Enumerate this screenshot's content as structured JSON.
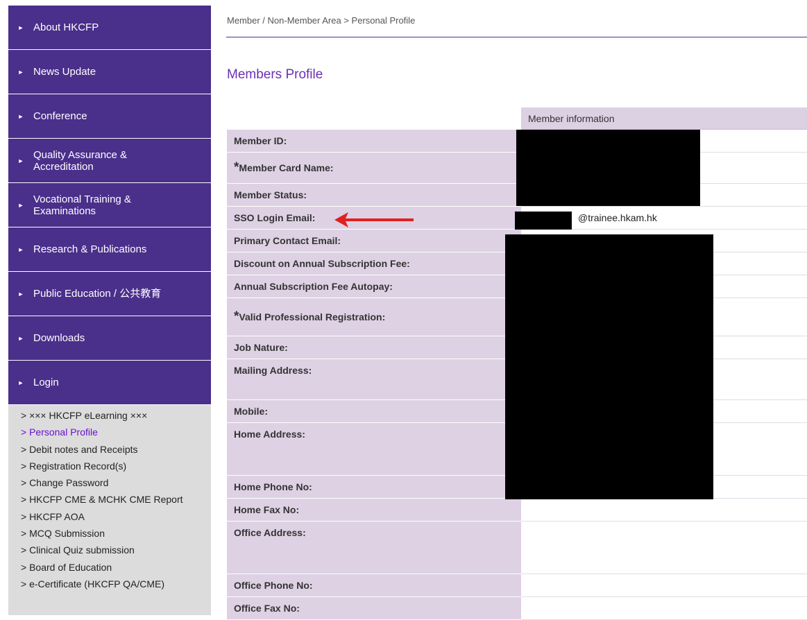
{
  "colors": {
    "nav_bg": "#4a2f8b",
    "submenu_bg": "#dcdcdc",
    "active_link": "#6a0fd6",
    "title": "#6a2fb5",
    "label_bg": "#ddd1e3",
    "arrow": "#e02020",
    "mask": "#000000"
  },
  "sidebar": {
    "nav": [
      {
        "label": "About HKCFP",
        "icon": "triangle-right-icon"
      },
      {
        "label": "News Update",
        "icon": "triangle-right-icon"
      },
      {
        "label": "Conference",
        "icon": "triangle-right-icon"
      },
      {
        "label": "Quality Assurance & Accreditation",
        "icon": "triangle-right-icon"
      },
      {
        "label": "Vocational Training & Examinations",
        "icon": "triangle-right-icon"
      },
      {
        "label": "Research & Publications",
        "icon": "triangle-right-icon"
      },
      {
        "label": "Public Education / 公共教育",
        "icon": "triangle-right-icon"
      },
      {
        "label": "Downloads",
        "icon": "triangle-right-icon"
      },
      {
        "label": "Login",
        "icon": "triangle-right-icon"
      }
    ],
    "submenu": [
      "> ××× HKCFP eLearning ×××",
      "> Personal Profile",
      "> Debit notes and Receipts",
      "> Registration Record(s)",
      "> Change Password",
      "> HKCFP CME & MCHK CME Report",
      "> HKCFP AOA",
      "> MCQ Submission",
      "> Clinical Quiz submission",
      "> Board of Education",
      "> e-Certificate (HKCFP QA/CME)"
    ],
    "active_submenu_index": 1
  },
  "main": {
    "breadcrumb": "Member / Non-Member Area > Personal Profile",
    "title": "Members Profile",
    "section_header": "Member information",
    "required_marker": "*",
    "fields": [
      {
        "label": "Member ID:",
        "value": ""
      },
      {
        "label": "Member Card Name:",
        "value": "",
        "required": true
      },
      {
        "label": "Member Status:",
        "value": ""
      },
      {
        "label": "SSO Login Email:",
        "value": "@trainee.hkam.hk"
      },
      {
        "label": "Primary Contact Email:",
        "value": ""
      },
      {
        "label": "Discount on Annual Subscription Fee:",
        "value": ""
      },
      {
        "label": "Annual Subscription Fee Autopay:",
        "value": ""
      },
      {
        "label": "Valid Professional Registration:",
        "value": "",
        "required": true
      },
      {
        "label": "Job Nature:",
        "value": ""
      },
      {
        "label": "Mailing Address:",
        "value": ""
      },
      {
        "label": "Mobile:",
        "value": ""
      },
      {
        "label": "Home Address:",
        "value": ""
      },
      {
        "label": "Home Phone No:",
        "value": ""
      },
      {
        "label": "Home Fax No:",
        "value": ""
      },
      {
        "label": "Office Address:",
        "value": ""
      },
      {
        "label": "Office Phone No:",
        "value": ""
      },
      {
        "label": "Office Fax No:",
        "value": ""
      }
    ]
  }
}
